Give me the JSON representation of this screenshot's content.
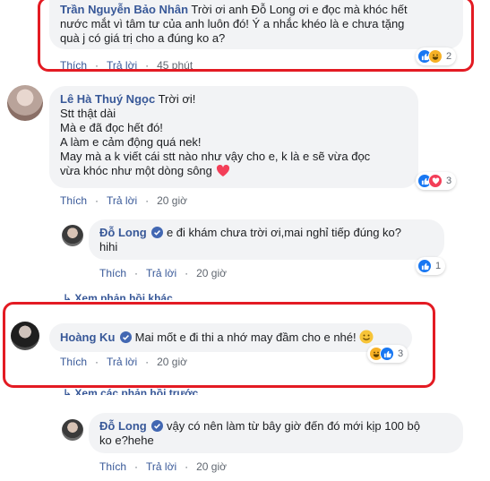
{
  "colors": {
    "author": "#385898",
    "bubble": "#f2f3f5",
    "highlight_box": "#e31b23",
    "like": "#1877f2",
    "haha": "#f7b125",
    "love": "#f33e58"
  },
  "actions": {
    "like": "Thích",
    "reply": "Trả lời",
    "dot": "·"
  },
  "comments": [
    {
      "author": "Trần Nguyễn Bảo Nhân",
      "lines": [
        "Trời ơi anh Đỗ Long ơi e đọc mà khóc hết",
        "nước mắt vì tâm tư của anh luôn đó! Ý a nhắc khéo là e chưa tặng",
        "quà j có giá trị cho a đúng ko a?"
      ],
      "time": "45 phút",
      "reactions": {
        "icons": [
          "like-icon",
          "haha-icon"
        ],
        "count": "2"
      }
    },
    {
      "author": "Lê Hà Thuý Ngọc",
      "lines": [
        "Trời ơi!",
        "Stt thật dài",
        "Mà e đã đọc hết đó!",
        "A làm e cảm động quá nek!",
        "May mà a k viết cái stt nào như vậy cho e, k là e sẽ vừa đọc",
        "vừa khóc như một dòng sông"
      ],
      "time": "20 giờ",
      "reactions": {
        "icons": [
          "like-icon",
          "love-icon"
        ],
        "count": "3"
      }
    },
    {
      "author": "Đỗ Long",
      "lines": [
        "e đi khám chưa trời ơi,mai nghỉ tiếp đúng ko?",
        "hihi"
      ],
      "time": "20 giờ",
      "reactions": {
        "icons": [
          "like-icon"
        ],
        "count": "1"
      }
    },
    {
      "author": "Hoàng Ku",
      "lines": [
        "Mai mốt e đi thi a nhớ may đầm cho e nhé!"
      ],
      "time": "20 giờ",
      "reactions": {
        "icons": [
          "haha-icon",
          "like-icon"
        ],
        "count": "3"
      }
    },
    {
      "author": "Đỗ Long",
      "lines": [
        "vậy có nên làm từ bây giờ đến đó mới kịp 100 bộ",
        "ko e?hehe"
      ],
      "time": "20 giờ"
    }
  ],
  "more_replies_1": "Xem phản hồi khác",
  "more_replies_2": "Xem các phản hồi trước"
}
